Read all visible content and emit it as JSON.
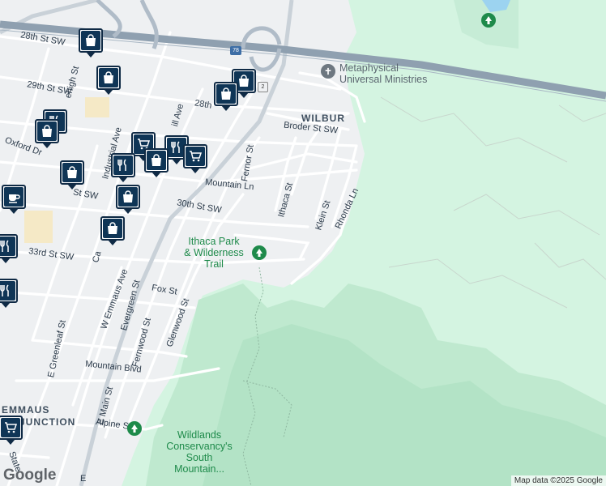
{
  "map": {
    "areas": {
      "wilbur": "WILBUR",
      "emmaus_junction_line1": "EMMAUS",
      "emmaus_junction_line2": "JUNCTION"
    },
    "streets": {
      "s28th": "28th St SW",
      "s29th": "29th St SW",
      "s28th_short": "28th",
      "s30th": "30th St SW",
      "s33rd": "33rd St SW",
      "s32nd_suffix": "St SW",
      "lehigh": "ehigh St",
      "oxford": "Oxford Dr",
      "industrial": "Industrial Ave",
      "hill": "ill Ave",
      "broder": "Broder St SW",
      "mountain_ln": "Mountain Ln",
      "fernor": "Fernor St",
      "ithaca": "Ithaca St",
      "klein": "Klein St",
      "rhonda": "Rhonda Ln",
      "w_emmaus": "W Emmaus Ave",
      "evergreen": "Evergreen St",
      "fox": "Fox St",
      "glenwood": "Glenwood St",
      "fernwood": "Fernwood St",
      "e_greenleaf": "E Greenleaf St",
      "e_main": "E Main St",
      "mountain_blvd": "Mountain Blvd",
      "alpine": "Alpine St",
      "state": "State",
      "cal": "Ca",
      "e_partial": "E"
    },
    "highway_shield": "78",
    "route_shield": "2",
    "pois": {
      "metaphysical": "Metaphysical\nUniversal Ministries",
      "ithaca_park": "Ithaca Park\n& Wilderness\nTrail",
      "wildlands": "Wildlands\nConservancy's\nSouth\nMountain..."
    },
    "pins": [
      {
        "icon": "shopping-bag-icon"
      },
      {
        "icon": "shopping-bag-icon"
      },
      {
        "icon": "shopping-bag-icon"
      },
      {
        "icon": "shopping-bag-icon"
      },
      {
        "icon": "shopping-bag-icon"
      },
      {
        "icon": "shopping-bag-icon"
      },
      {
        "icon": "shopping-bag-icon"
      },
      {
        "icon": "shopping-bag-icon"
      },
      {
        "icon": "restaurant-icon"
      },
      {
        "icon": "restaurant-icon"
      },
      {
        "icon": "shopping-cart-icon"
      },
      {
        "icon": "shopping-cart-icon"
      },
      {
        "icon": "coffee-icon"
      },
      {
        "icon": "restaurant-icon"
      }
    ],
    "colors": {
      "park_light": "#d6f5e3",
      "park_dark": "#bfe9cf",
      "highway": "#8fa0b0",
      "road": "#ffffff",
      "pin_fill": "#0f3556"
    }
  },
  "footer": {
    "logo": "Google",
    "credit": "Map data ©2025 Google"
  }
}
